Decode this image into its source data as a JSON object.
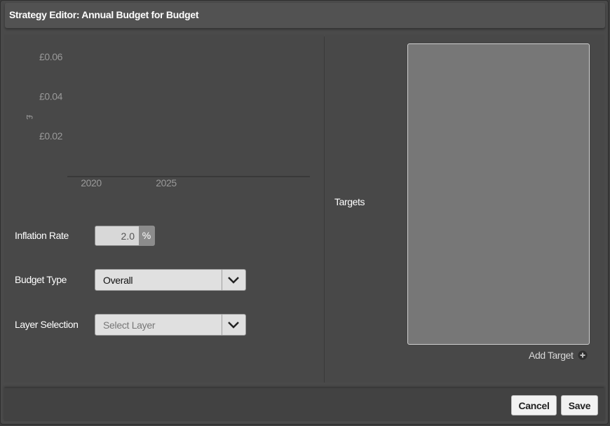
{
  "dialog": {
    "title": "Strategy Editor: Annual Budget for Budget"
  },
  "chart_data": {
    "type": "line",
    "title": "",
    "xlabel": "",
    "ylabel": "£",
    "x_ticks": [
      "2020",
      "2025"
    ],
    "y_ticks": [
      "£0.06",
      "£0.04",
      "£0.02"
    ],
    "series": [],
    "grid": false
  },
  "form": {
    "inflation": {
      "label": "Inflation Rate",
      "value": "2.0",
      "unit": "%"
    },
    "budget_type": {
      "label": "Budget Type",
      "value": "Overall"
    },
    "layer": {
      "label": "Layer Selection",
      "placeholder": "Select Layer"
    }
  },
  "targets": {
    "label": "Targets",
    "add_label": "Add Target",
    "items": []
  },
  "footer": {
    "cancel_label": "Cancel",
    "save_label": "Save"
  },
  "icons": {
    "dropdown": "chevron-down-icon",
    "add": "plus-circle-icon"
  }
}
